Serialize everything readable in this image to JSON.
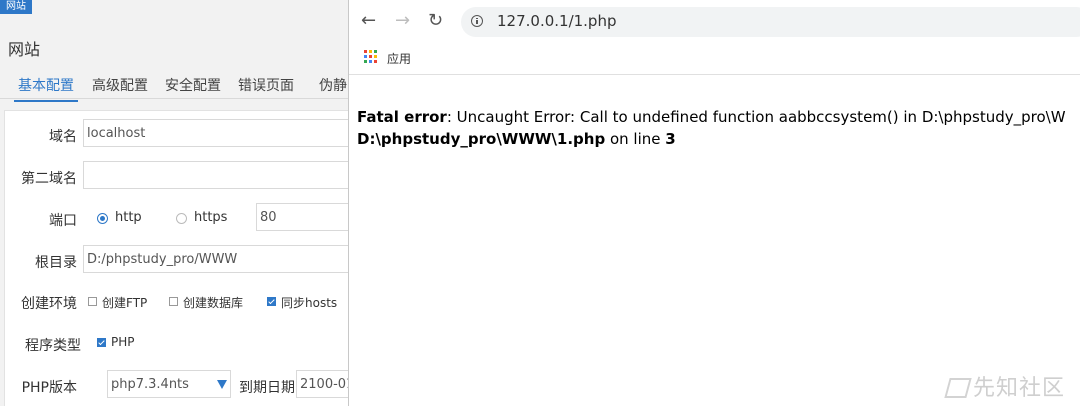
{
  "left_panel": {
    "badge": "网站",
    "title": "网站",
    "tabs": [
      "基本配置",
      "高级配置",
      "安全配置",
      "错误页面",
      "伪静"
    ],
    "active_tab_index": 0,
    "form": {
      "domain_label": "域名",
      "domain_value": "localhost",
      "second_domain_label": "第二域名",
      "second_domain_value": "",
      "port_label": "端口",
      "port_http": "http",
      "port_https": "https",
      "port_selected": "http",
      "port_value": "80",
      "root_label": "根目录",
      "root_value": "D:/phpstudy_pro/WWW",
      "env_label": "创建环境",
      "env_options": [
        {
          "label": "创建FTP",
          "checked": false
        },
        {
          "label": "创建数据库",
          "checked": false
        },
        {
          "label": "同步hosts",
          "checked": true
        }
      ],
      "type_label": "程序类型",
      "type_option": {
        "label": "PHP",
        "checked": true
      },
      "php_label": "PHP版本",
      "php_value": "php7.3.4nts",
      "expire_label": "到期日期",
      "expire_value": "2100-01"
    }
  },
  "browser": {
    "url": "127.0.0.1/1.php",
    "bookmark": "应用",
    "error": {
      "label": "Fatal error",
      "message": ": Uncaught Error: Call to undefined function aabbccsystem() in D:\\phpstudy_pro\\W",
      "path": "D:\\phpstudy_pro\\WWW\\1.php",
      "on_line_text": " on line ",
      "line": "3"
    },
    "watermark": "先知社区"
  },
  "colors": {
    "accent": "#2e78c8",
    "panel_bg": "#f2f2f2"
  }
}
